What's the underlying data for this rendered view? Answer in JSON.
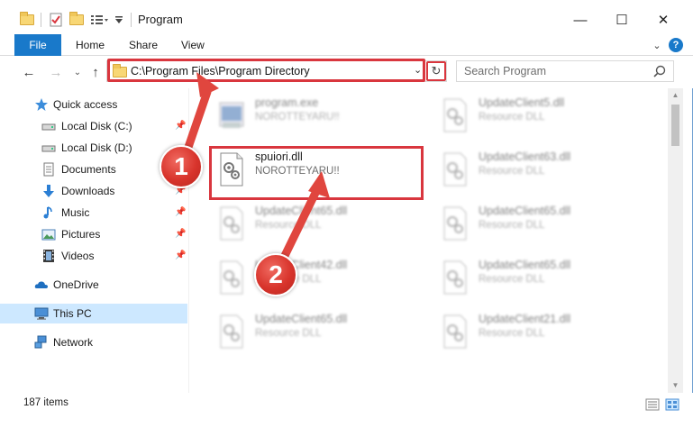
{
  "window": {
    "title": "Program",
    "minimize_glyph": "—",
    "maximize_glyph": "☐",
    "close_glyph": "✕",
    "help_glyph": "?",
    "ribbon_toggle_glyph": "⌄"
  },
  "ribbon": {
    "tabs": [
      "File",
      "Home",
      "Share",
      "View"
    ]
  },
  "address": {
    "path": "C:\\Program Files\\Program Directory",
    "refresh_glyph": "↻"
  },
  "search": {
    "placeholder": "Search Program"
  },
  "nav": {
    "back": "←",
    "forward": "→",
    "recent": "⌄",
    "up": "↑",
    "items": [
      {
        "label": "Quick access",
        "icon": "star-icon",
        "pinned": false
      },
      {
        "label": "Local Disk (C:)",
        "icon": "drive-icon",
        "pinned": true
      },
      {
        "label": "Local Disk (D:)",
        "icon": "drive-icon",
        "pinned": false
      },
      {
        "label": "Documents",
        "icon": "documents-icon",
        "pinned": true
      },
      {
        "label": "Downloads",
        "icon": "download-icon",
        "pinned": true
      },
      {
        "label": "Music",
        "icon": "music-icon",
        "pinned": true
      },
      {
        "label": "Pictures",
        "icon": "pictures-icon",
        "pinned": true
      },
      {
        "label": "Videos",
        "icon": "videos-icon",
        "pinned": true
      },
      {
        "label": "OneDrive",
        "icon": "cloud-icon",
        "pinned": false
      },
      {
        "label": "This PC",
        "icon": "computer-icon",
        "pinned": false,
        "selected": true
      },
      {
        "label": "Network",
        "icon": "network-icon",
        "pinned": false
      }
    ]
  },
  "files": {
    "col1": [
      {
        "name": "program.exe",
        "desc": "NOROTTEYARU!!",
        "blurred": true
      },
      {
        "name": "spuiori.dll",
        "desc": "NOROTTEYARU!!",
        "blurred": false
      },
      {
        "name": "UpdateClient65.dll",
        "desc": "Resource DLL",
        "blurred": true
      },
      {
        "name": "UpdateClient42.dll",
        "desc": "Resource DLL",
        "blurred": true
      },
      {
        "name": "UpdateClient65.dll",
        "desc": "Resource DLL",
        "blurred": true
      }
    ],
    "col2": [
      {
        "name": "UpdateClient5.dll",
        "desc": "Resource DLL",
        "blurred": true
      },
      {
        "name": "UpdateClient63.dll",
        "desc": "Resource DLL",
        "blurred": true
      },
      {
        "name": "UpdateClient65.dll",
        "desc": "Resource DLL",
        "blurred": true
      },
      {
        "name": "UpdateClient65.dll",
        "desc": "Resource DLL",
        "blurred": true
      },
      {
        "name": "UpdateClient21.dll",
        "desc": "Resource DLL",
        "blurred": true
      }
    ]
  },
  "status": {
    "item_count": "187 items"
  },
  "callouts": [
    "1",
    "2"
  ],
  "colors": {
    "accent": "#1979ca",
    "highlight": "#d9363e",
    "selected_bg": "#cde8ff"
  }
}
